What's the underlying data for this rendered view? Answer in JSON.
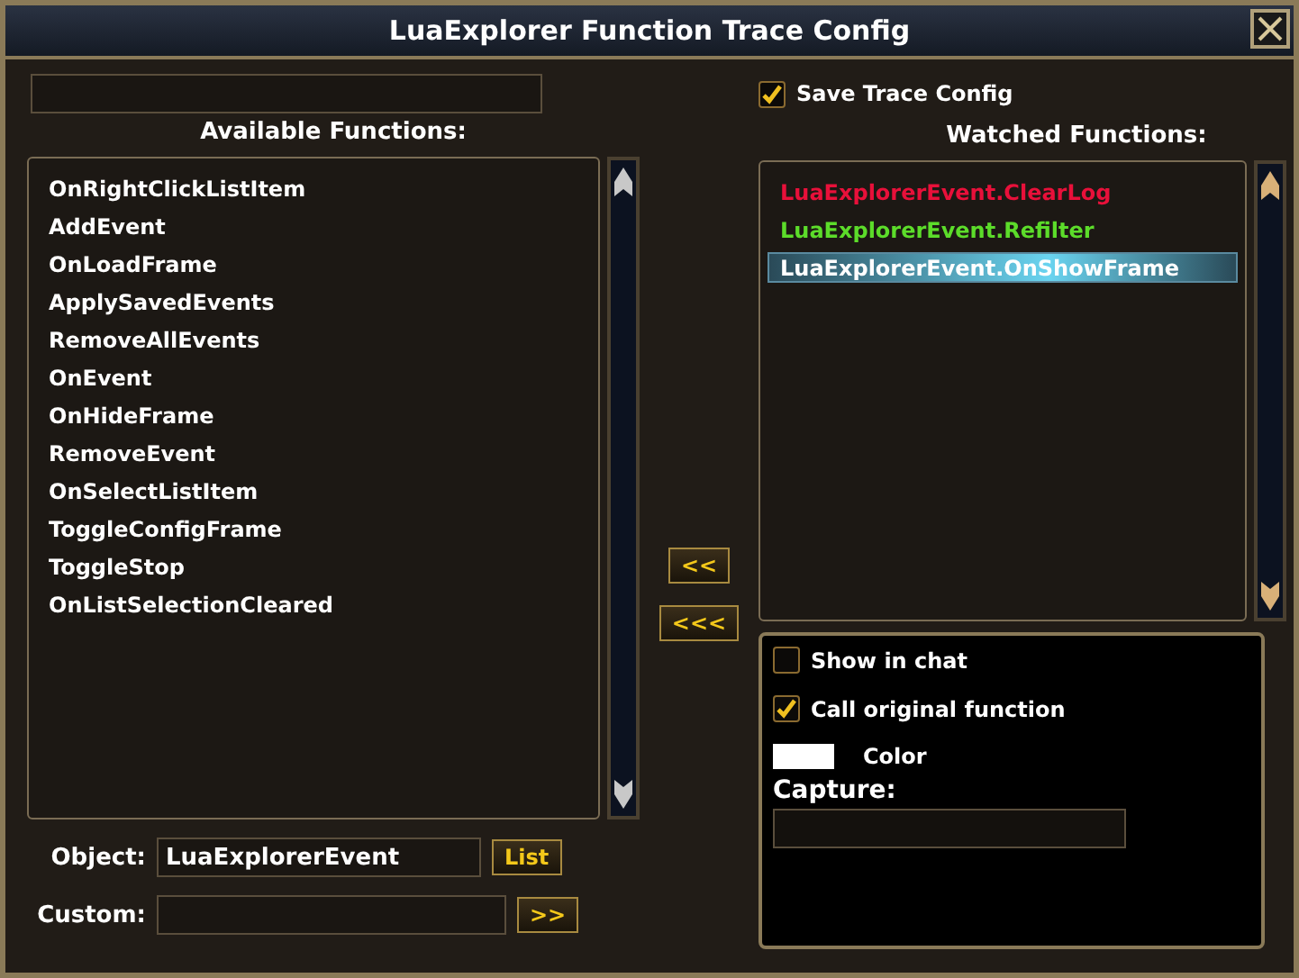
{
  "window": {
    "title": "LuaExplorer Function Trace Config"
  },
  "save_trace_config": {
    "label": "Save Trace Config",
    "checked": true
  },
  "available": {
    "heading": "Available Functions:",
    "items": [
      {
        "label": "OnRightClickListItem",
        "selected": false
      },
      {
        "label": "AddEvent",
        "selected": false
      },
      {
        "label": "OnLoadFrame",
        "selected": false
      },
      {
        "label": "ApplySavedEvents",
        "selected": false
      },
      {
        "label": "RemoveAllEvents",
        "selected": false
      },
      {
        "label": "OnEvent",
        "selected": false
      },
      {
        "label": "OnHideFrame",
        "selected": false
      },
      {
        "label": "RemoveEvent",
        "selected": false
      },
      {
        "label": "OnSelectListItem",
        "selected": false
      },
      {
        "label": "ToggleConfigFrame",
        "selected": false
      },
      {
        "label": "ToggleStop",
        "selected": false
      },
      {
        "label": "OnListSelectionCleared",
        "selected": false
      }
    ]
  },
  "move_buttons": [
    "<<",
    "<<<"
  ],
  "watched": {
    "heading": "Watched Functions:",
    "items": [
      {
        "label": "LuaExplorerEvent.ClearLog",
        "color": "#e8103a",
        "selected": false
      },
      {
        "label": "LuaExplorerEvent.Refilter",
        "color": "#5cdc2a",
        "selected": false
      },
      {
        "label": "LuaExplorerEvent.OnShowFrame",
        "color": "#ffffff",
        "selected": true
      }
    ]
  },
  "options": [
    {
      "label": "Show in chat",
      "checked": false
    },
    {
      "label": "Call original function",
      "checked": true
    }
  ],
  "color": {
    "label": "Color",
    "color": "#ffffff"
  },
  "capture": {
    "label": "Capture:"
  },
  "object": {
    "label": "Object:",
    "value": "LuaExplorerEvent",
    "button": "List"
  },
  "custom": {
    "label": "Custom:",
    "button": ">>"
  }
}
